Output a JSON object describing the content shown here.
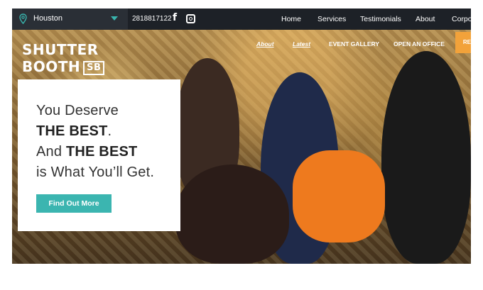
{
  "topbar": {
    "location": "Houston",
    "phone": "2818817122",
    "social": [
      "facebook-icon",
      "instagram-icon"
    ],
    "nav": [
      "Home",
      "Services",
      "Testimonials",
      "About",
      "Corpo"
    ]
  },
  "hero": {
    "logo_line1": "SHUTTER",
    "logo_line2": "BOOTH",
    "logo_badge": "SB",
    "subnav": [
      "About",
      "Latest",
      "EVENT GALLERY",
      "OPEN AN OFFICE"
    ],
    "cta_tab": "RE",
    "card": {
      "line1": "You Deserve",
      "line2_bold": "THE BEST",
      "line2_end": ".",
      "line3_start": "And ",
      "line3_bold": "THE BEST",
      "line4": "is What You’ll Get.",
      "button": "Find Out More"
    }
  },
  "colors": {
    "topbar_bg": "#1d2127",
    "accent_teal": "#3bb5b0",
    "cta_orange": "#f2a23a"
  }
}
